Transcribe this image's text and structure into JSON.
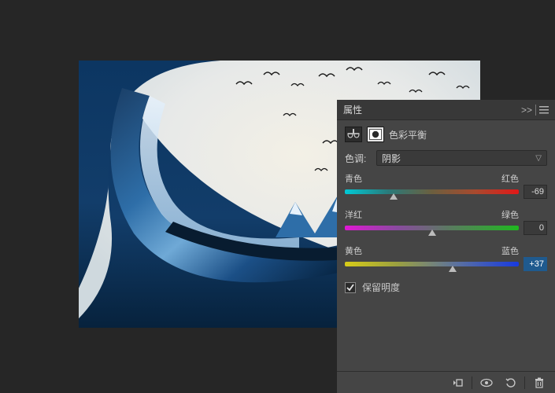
{
  "panel": {
    "title": "属性",
    "collapse_glyph": ">>",
    "adjustment_name": "色彩平衡",
    "tone_label": "色调:",
    "tone_value": "阴影",
    "sliders": [
      {
        "left": "青色",
        "right": "红色",
        "value": "-69",
        "thumb_pct": 28,
        "track_class": "cyan-red",
        "highlight": false
      },
      {
        "left": "洋红",
        "right": "绿色",
        "value": "0",
        "thumb_pct": 50,
        "track_class": "mag-green",
        "highlight": false
      },
      {
        "left": "黄色",
        "right": "蓝色",
        "value": "+37",
        "thumb_pct": 62,
        "track_class": "yel-blue",
        "highlight": true
      }
    ],
    "preserve_luminosity": "保留明度"
  }
}
